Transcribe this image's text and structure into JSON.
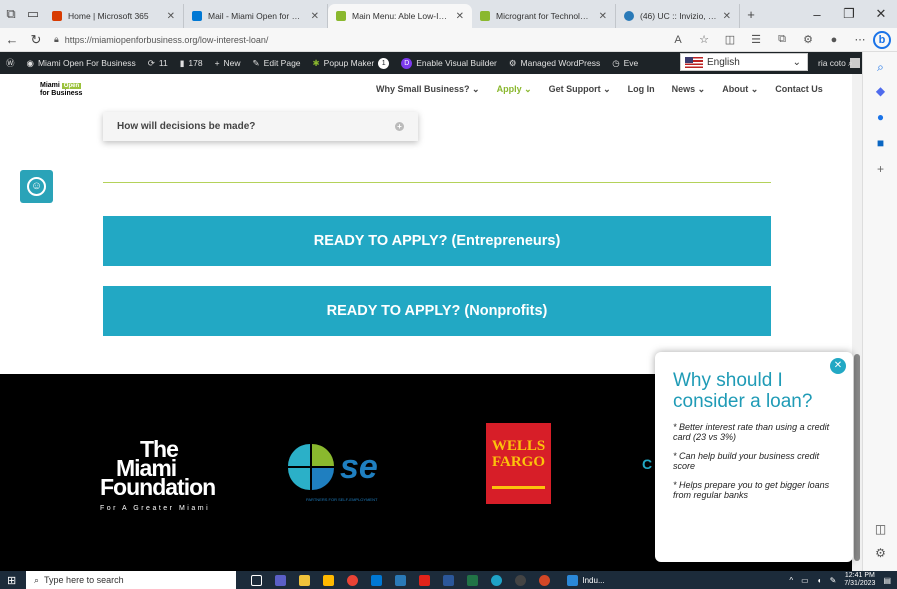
{
  "browser": {
    "tabs": [
      {
        "title": "Home | Microsoft 365",
        "color": "#d83b01"
      },
      {
        "title": "Mail - Miami Open for Busi",
        "color": "#0078d4"
      },
      {
        "title": "Main Menu: Able Low-Inter",
        "color": "#8ab82e",
        "active": true
      },
      {
        "title": "Microgrant for Technology",
        "color": "#8ab82e"
      },
      {
        "title": "(46) UC :: Invizio, LLC",
        "color": "#2a7ab8"
      }
    ],
    "url": "https://miamiopenforbusiness.org/low-interest-loan/"
  },
  "wp_bar": {
    "site": "Miami Open For Business",
    "updates": "11",
    "comments": "178",
    "new": "New",
    "edit": "Edit Page",
    "popup": "Popup Maker",
    "popup_count": "1",
    "visual": "Enable Visual Builder",
    "managed": "Managed WordPress",
    "ev": "Eve",
    "user": "ria coto",
    "language": "English"
  },
  "site": {
    "logo_line1": "Miami",
    "logo_tag": "Open",
    "logo_line2": "for Business",
    "nav": [
      {
        "label": "Why Small Business? ⌄"
      },
      {
        "label": "Apply ⌄",
        "active": true
      },
      {
        "label": "Get Support ⌄"
      },
      {
        "label": "Log In"
      },
      {
        "label": "News ⌄"
      },
      {
        "label": "About ⌄"
      },
      {
        "label": "Contact Us"
      }
    ],
    "faq_question": "How will decisions be made?",
    "cta_entrepreneurs": "READY TO APPLY? (Entrepreneurs)",
    "cta_nonprofits": "READY TO APPLY? (Nonprofits)"
  },
  "footer": {
    "tmf_line1": "The",
    "tmf_line2": "Miami",
    "tmf_line3": "Foundation",
    "tmf_tag": "For A Greater Miami",
    "pse_caption": "PARTNERS FOR SELF-EMPLOYMENT",
    "wf_line1": "WELLS",
    "wf_line2": "FARGO",
    "cut_text": "C"
  },
  "popup": {
    "title": "Why should I consider a loan?",
    "points": [
      "* Better interest rate than using a credit card (23 vs 3%)",
      "* Can help build your business credit score",
      "* Helps prepare you to get bigger loans from regular banks"
    ]
  },
  "taskbar": {
    "search_placeholder": "Type here to search",
    "indu": "Indu...",
    "time": "12:41 PM",
    "date": "7/31/2023"
  },
  "colors": {
    "brand_teal": "#22a8c4",
    "brand_green": "#8ab82e",
    "wp_dark": "#1d2327"
  }
}
